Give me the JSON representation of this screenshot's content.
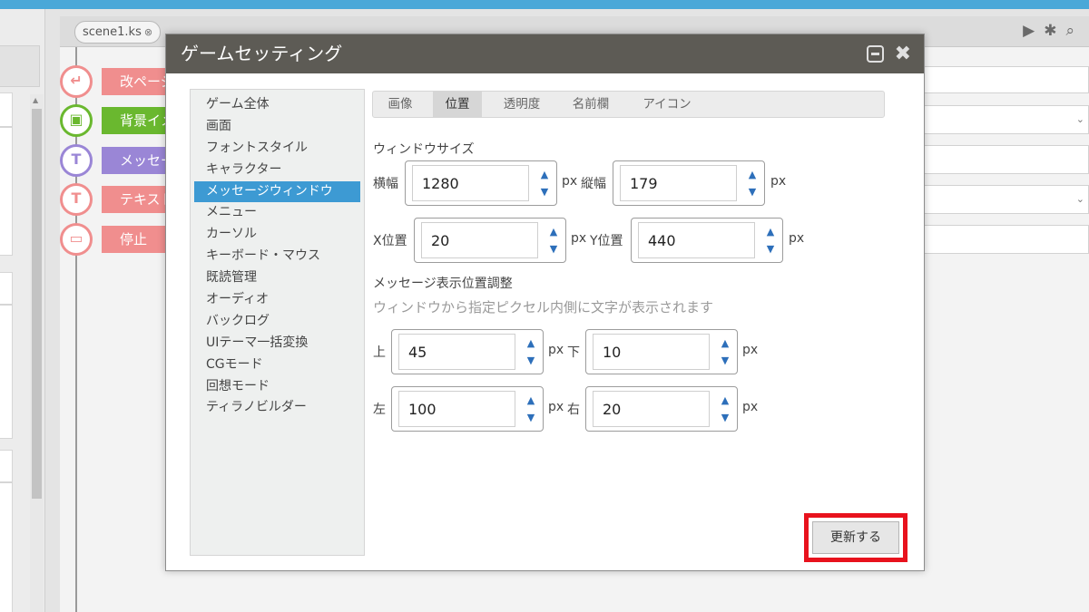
{
  "editor": {
    "file_tab": "scene1.ks",
    "file_tab_close": "⊗",
    "tool_icons": [
      "▶",
      "✱",
      "⌕"
    ]
  },
  "commands": [
    {
      "label": "改ページ",
      "color": "#f08e8e",
      "icon": "↵"
    },
    {
      "label": "背景イメージ",
      "color": "#6ab82f",
      "icon": "▣"
    },
    {
      "label": "メッセージ",
      "color": "#9a86d6",
      "icon": "T"
    },
    {
      "label": "テキスト",
      "color": "#f08e8e",
      "icon": "T"
    },
    {
      "label": "停止",
      "color": "#f08e8e",
      "icon": "▭"
    }
  ],
  "dialog": {
    "title": "ゲームセッティング",
    "menu": [
      "ゲーム全体",
      "画面",
      "フォントスタイル",
      "キャラクター",
      "メッセージウィンドウ",
      "メニュー",
      "カーソル",
      "キーボード・マウス",
      "既読管理",
      "オーディオ",
      "バックログ",
      "UIテーマ一括変換",
      "CGモード",
      "回想モード",
      "ティラノビルダー"
    ],
    "active_menu_index": 4,
    "tabs": [
      "画像",
      "位置",
      "透明度",
      "名前欄",
      "アイコン"
    ],
    "active_tab_index": 1,
    "window_size": {
      "heading": "ウィンドウサイズ",
      "width_label": "横幅",
      "width_value": "1280",
      "height_label": "縦幅",
      "height_value": "179",
      "unit": "px"
    },
    "position": {
      "x_label": "X位置",
      "x_value": "20",
      "y_label": "Y位置",
      "y_value": "440"
    },
    "margin": {
      "heading": "メッセージ表示位置調整",
      "hint": "ウィンドウから指定ピクセル内側に文字が表示されます",
      "top_label": "上",
      "top_value": "45",
      "bottom_label": "下",
      "bottom_value": "10",
      "left_label": "左",
      "left_value": "100",
      "right_label": "右",
      "right_value": "20"
    },
    "update_button": "更新する"
  },
  "colors": {
    "title_bar": "#5d5b55",
    "active_menu": "#3d9ad3",
    "highlight_box": "#e8121d",
    "top_bar": "#4aa8d8"
  }
}
